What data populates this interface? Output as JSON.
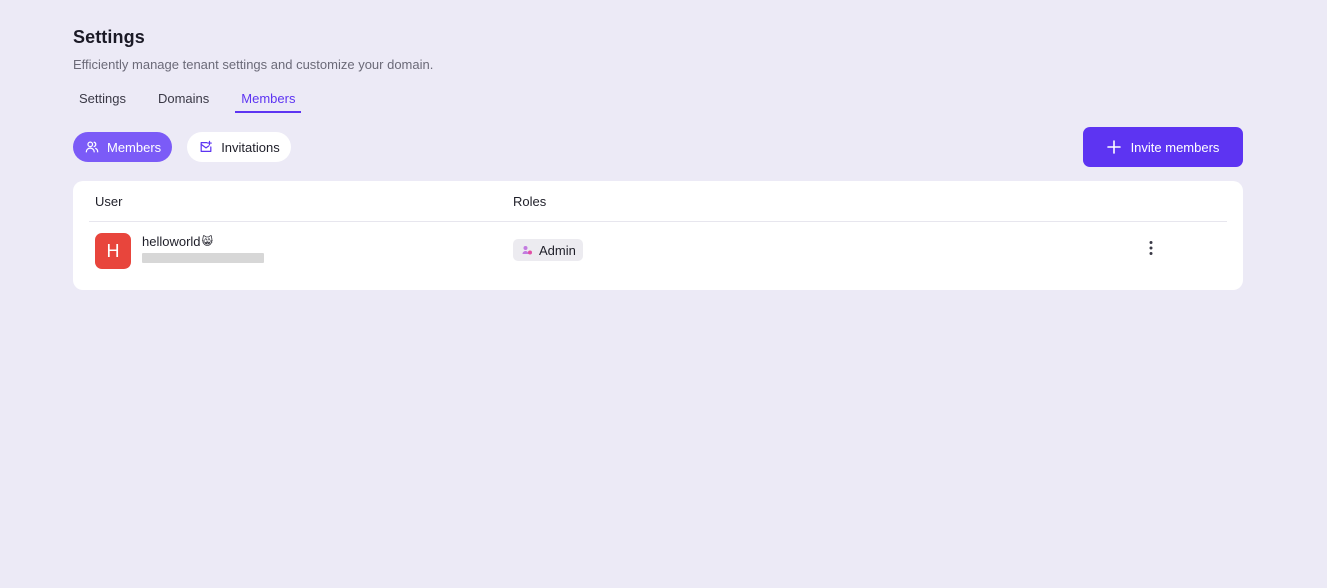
{
  "header": {
    "title": "Settings",
    "subtitle": "Efficiently manage tenant settings and customize your domain."
  },
  "tabs": [
    {
      "label": "Settings",
      "active": false
    },
    {
      "label": "Domains",
      "active": false
    },
    {
      "label": "Members",
      "active": true
    }
  ],
  "filters": [
    {
      "label": "Members",
      "icon": "users-icon",
      "active": true
    },
    {
      "label": "Invitations",
      "icon": "invitation-mail-icon",
      "active": false
    }
  ],
  "actions": {
    "invite_label": "Invite members",
    "invite_icon": "plus-icon"
  },
  "table": {
    "columns": [
      "User",
      "Roles"
    ],
    "rows": [
      {
        "avatar_letter": "H",
        "username": "helloworld",
        "username_emoji": "😸",
        "role": "Admin",
        "role_icon": "admin-role-icon"
      }
    ]
  },
  "colors": {
    "background": "#eceaf6",
    "accent": "#5d34f2",
    "accent_light": "#7b5bf7",
    "avatar": "#e8453c"
  }
}
